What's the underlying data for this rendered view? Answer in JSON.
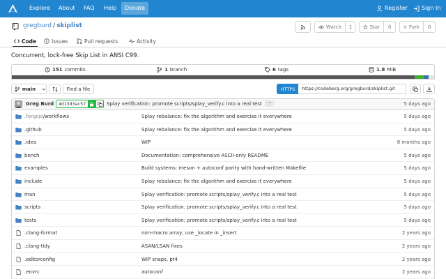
{
  "nav": {
    "items": [
      {
        "label": "Explore"
      },
      {
        "label": "About"
      },
      {
        "label": "FAQ"
      },
      {
        "label": "Help"
      },
      {
        "label": "Donate"
      }
    ],
    "register": "Register",
    "signin": "Sign In"
  },
  "repo": {
    "owner": "gregburd",
    "separator": "/",
    "name": "skiplist",
    "watch_label": "Watch",
    "watch_count": "1",
    "star_label": "Star",
    "star_count": "0",
    "fork_label": "Fork",
    "fork_count": "0",
    "description": "Concurrent, lock-free Skip List in ANSI C99."
  },
  "tabs": [
    {
      "label": "Code"
    },
    {
      "label": "Issues"
    },
    {
      "label": "Pull requests"
    },
    {
      "label": "Activity"
    }
  ],
  "stats": {
    "commits_value": "151",
    "commits_label": "commits",
    "branches_value": "1",
    "branches_label": "branch",
    "tags_value": "6",
    "tags_label": "tags",
    "size_value": "1.8",
    "size_unit": "MiB"
  },
  "language_colors": [
    "#555555",
    "#40b030",
    "#3572a5",
    "#e4e4e4"
  ],
  "toolbar": {
    "branch": "main",
    "find_file": "Find a file",
    "https_label": "HTTPS",
    "clone_url": "https://codeberg.org/gregburd/skiplist.git"
  },
  "last_commit": {
    "author": "Greg Burd",
    "sha": "4d13d3ac57",
    "message": "Splay verification: promote scripts/splay_verify.c into a real test",
    "ellipsis": "···",
    "time": "5 days ago"
  },
  "files": [
    {
      "type": "dir",
      "name_dim": ".forgejo",
      "name": "/workflows",
      "message": "Splay rebalance: fix the algorithm and exercise it everywhere",
      "time": "5 days ago"
    },
    {
      "type": "dir",
      "name_dim": "",
      "name": ".github",
      "message": "Splay rebalance: fix the algorithm and exercise it everywhere",
      "time": "5 days ago"
    },
    {
      "type": "dir",
      "name_dim": "",
      "name": ".idea",
      "message": "WIP",
      "time": "8 months ago"
    },
    {
      "type": "dir",
      "name_dim": "",
      "name": "bench",
      "message": "Documentation: comprehensive ASCII-only README",
      "time": "5 days ago"
    },
    {
      "type": "dir",
      "name_dim": "",
      "name": "examples",
      "message": "Build systems: meson + autoconf parity with hand-written Makefile",
      "time": "5 days ago"
    },
    {
      "type": "dir",
      "name_dim": "",
      "name": "include",
      "message": "Splay rebalance: fix the algorithm and exercise it everywhere",
      "time": "5 days ago"
    },
    {
      "type": "dir",
      "name_dim": "",
      "name": "man",
      "message": "Splay verification: promote scripts/splay_verify.c into a real test",
      "time": "5 days ago"
    },
    {
      "type": "dir",
      "name_dim": "",
      "name": "scripts",
      "message": "Splay verification: promote scripts/splay_verify.c into a real test",
      "time": "5 days ago"
    },
    {
      "type": "dir",
      "name_dim": "",
      "name": "tests",
      "message": "Splay verification: promote scripts/splay_verify.c into a real test",
      "time": "5 days ago"
    },
    {
      "type": "file",
      "name_dim": "",
      "name": ".clang-format",
      "message": "non-macro array, use _locate in _insert",
      "time": "2 years ago"
    },
    {
      "type": "file",
      "name_dim": "",
      "name": ".clang-tidy",
      "message": "ASAN/LSAN fixes",
      "time": "2 years ago"
    },
    {
      "type": "file",
      "name_dim": "",
      "name": ".editorconfig",
      "message": "WIP snaps, pt4",
      "time": "2 years ago"
    },
    {
      "type": "file",
      "name_dim": "",
      "name": ".envrc",
      "message": "autoconf",
      "time": "2 years ago"
    }
  ]
}
